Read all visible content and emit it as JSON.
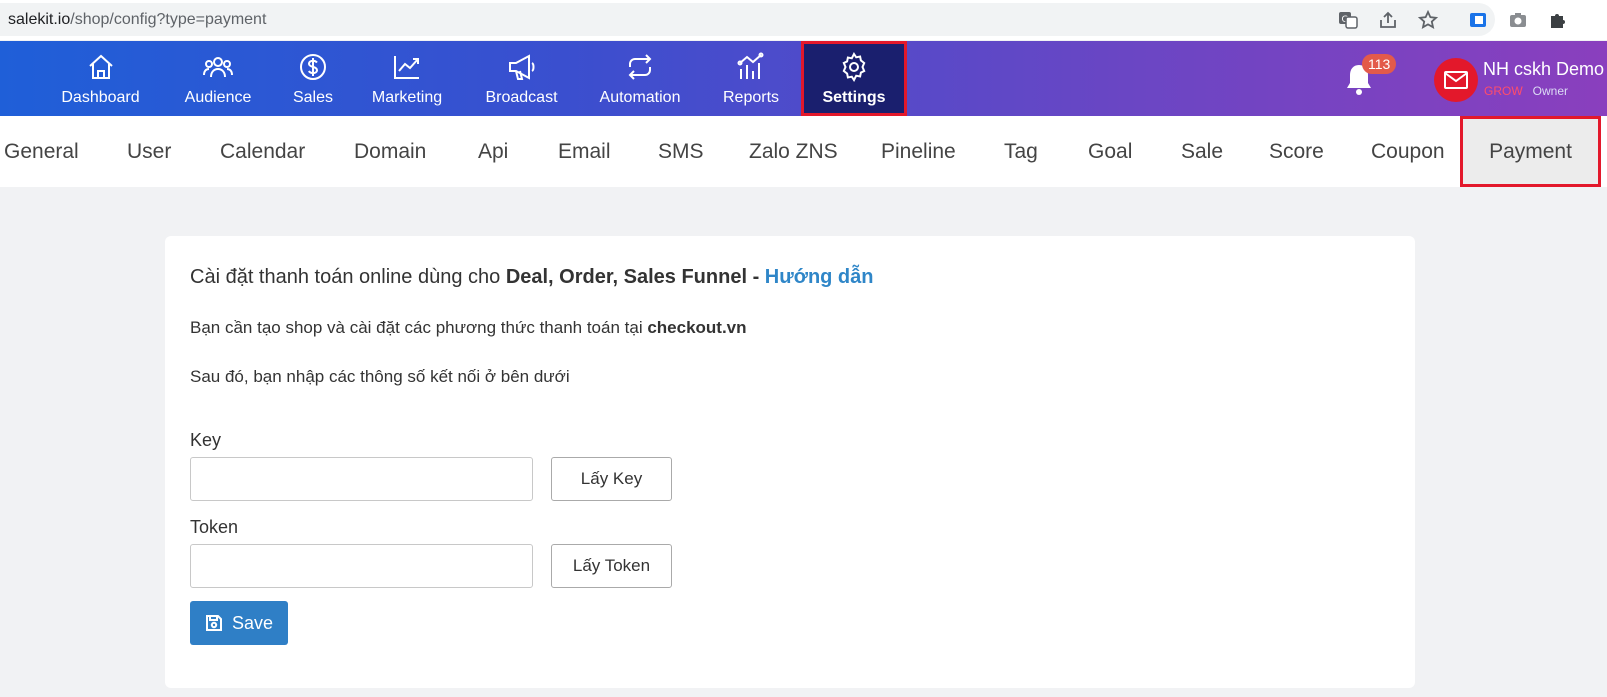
{
  "browser": {
    "url_host": "salekit.io",
    "url_path": "/shop/config?type=payment",
    "icons": [
      "translate-icon",
      "share-icon",
      "star-icon",
      "extension-icon",
      "camera-icon",
      "puzzle-icon"
    ]
  },
  "nav": {
    "items": [
      {
        "label": "Dashboard",
        "icon": "home-icon"
      },
      {
        "label": "Audience",
        "icon": "users-icon"
      },
      {
        "label": "Sales",
        "icon": "dollar-icon"
      },
      {
        "label": "Marketing",
        "icon": "trend-icon"
      },
      {
        "label": "Broadcast",
        "icon": "megaphone-icon"
      },
      {
        "label": "Automation",
        "icon": "repeat-icon"
      },
      {
        "label": "Reports",
        "icon": "bar-chart-icon"
      },
      {
        "label": "Settings",
        "icon": "gear-icon"
      }
    ],
    "active": "Settings",
    "notifications": "113",
    "user_name": "NH cskh Demo",
    "user_plan": "GROW",
    "user_role": "Owner"
  },
  "subtabs": {
    "items": [
      "General",
      "User",
      "Calendar",
      "Domain",
      "Api",
      "Email",
      "SMS",
      "Zalo ZNS",
      "Pineline",
      "Tag",
      "Goal",
      "Sale",
      "Score",
      "Coupon",
      "Payment"
    ],
    "active": "Payment"
  },
  "content": {
    "heading_prefix": "Cài đặt thanh toán online dùng cho ",
    "heading_bold": "Deal, Order, Sales Funnel",
    "heading_sep": " - ",
    "heading_link": "Hướng dẫn",
    "line1_prefix": "Bạn cần tạo shop và cài đặt các phương thức thanh toán tại ",
    "line1_bold": "checkout.vn",
    "line2": "Sau đó, bạn nhập các thông số kết nối ở bên dưới",
    "key_label": "Key",
    "key_value": "",
    "key_button": "Lấy Key",
    "token_label": "Token",
    "token_value": "",
    "token_button": "Lấy Token",
    "save_label": "Save"
  },
  "colors": {
    "nav_gradient_start": "#1f5fd8",
    "nav_gradient_end": "#8a3fbe",
    "active_nav_bg": "#1a1f6e",
    "highlight_border": "#e3182b",
    "link": "#2f86c8",
    "save_button": "#2f7fc6"
  }
}
